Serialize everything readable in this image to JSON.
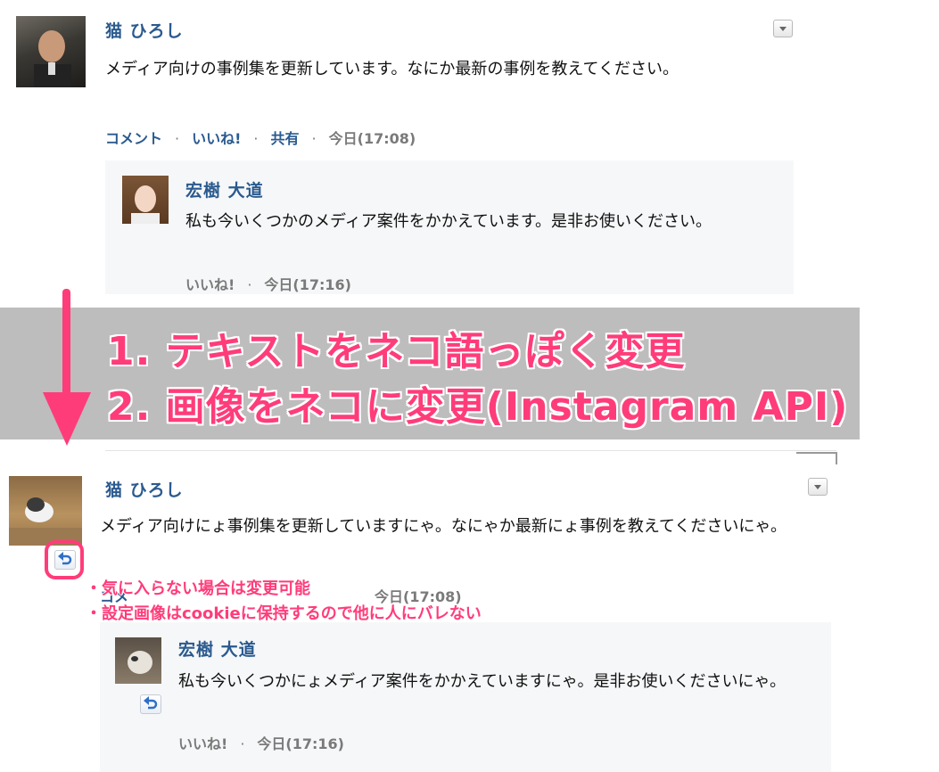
{
  "before": {
    "post": {
      "author": "猫 ひろし",
      "text": "メディア向けの事例集を更新しています。なにか最新の事例を教えてください。",
      "actions": {
        "comment": "コメント",
        "like": "いいね!",
        "share": "共有",
        "time": "今日(17:08)"
      }
    },
    "comment": {
      "author": "宏樹 大道",
      "text": "私も今いくつかのメディア案件をかかえています。是非お使いください。",
      "actions": {
        "like": "いいね!",
        "time": "今日(17:16)"
      }
    }
  },
  "banner": {
    "line1": "1. テキストをネコ語っぽく変更",
    "line2": "2. 画像をネコに変更(Instagram API)"
  },
  "after": {
    "post": {
      "author": "猫 ひろし",
      "text": "メディア向けにょ事例集を更新していますにゃ。なにゃか最新にょ事例を教えてくださいにゃ。",
      "actions_partial": "コメ",
      "time": "今日(17:08)"
    },
    "comment": {
      "author": "宏樹 大道",
      "text": "私も今いくつかにょメディア案件をかかえていますにゃ。是非お使いくださいにゃ。",
      "actions": {
        "like": "いいね!",
        "time": "今日(17:16)"
      }
    }
  },
  "notes": [
    "・気に入らない場合は変更可能",
    "・設定画像はcookieに保持するので他に人にバレない"
  ],
  "colors": {
    "accent": "#ff3c7a",
    "link": "#2a5a8f",
    "banner": "#bdbdbd"
  }
}
